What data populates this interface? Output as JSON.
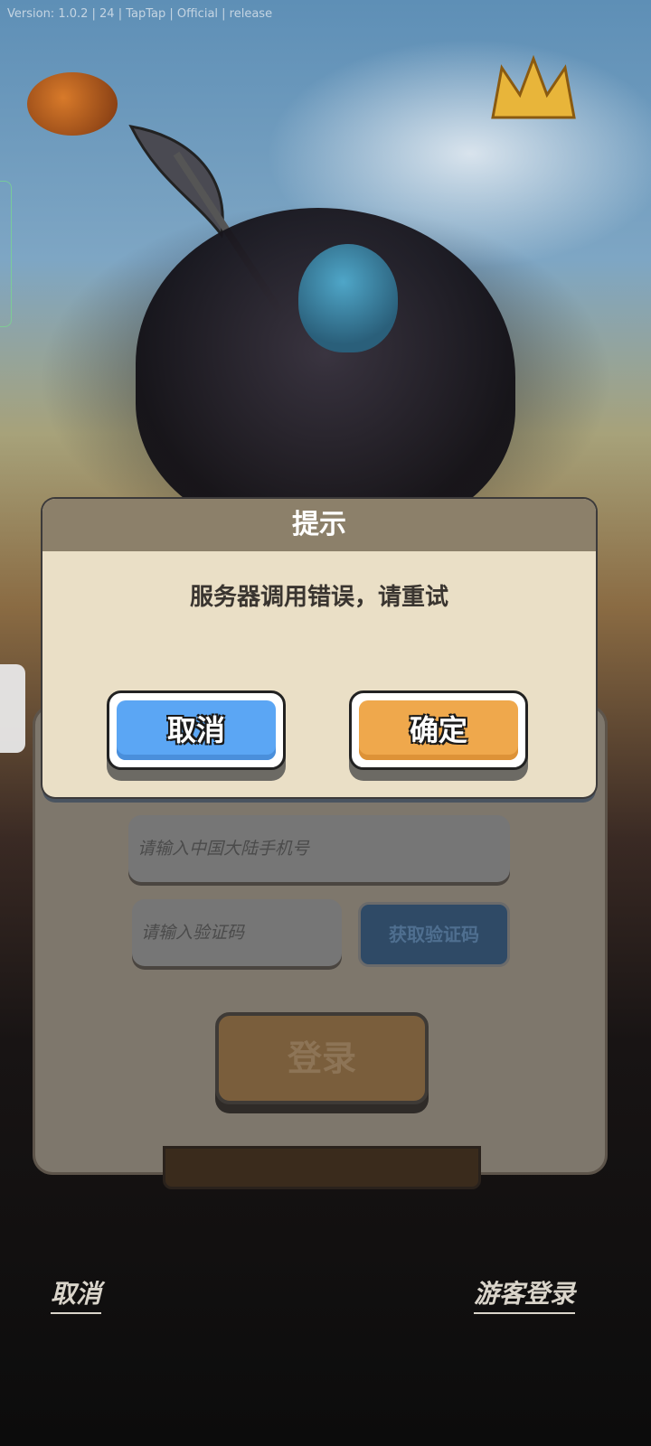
{
  "app": {
    "version_text": "Version: 1.0.2 | 24 | TapTap | Official | release"
  },
  "login_form": {
    "phone_placeholder": "请输入中国大陆手机号",
    "code_placeholder": "请输入验证码",
    "get_code_label": "获取验证码",
    "login_label": "登录"
  },
  "footer": {
    "cancel_label": "取消",
    "guest_login_label": "游客登录"
  },
  "dialog": {
    "title": "提示",
    "message": "服务器调用错误，请重试",
    "cancel_label": "取消",
    "ok_label": "确定"
  },
  "colors": {
    "dialog_bg": "#eadfc6",
    "dialog_header": "#8c806a",
    "cancel_button": "#5ba6f4",
    "ok_button": "#efa84c"
  },
  "icons": [
    "pumpkin-art",
    "crown-art",
    "hero-art"
  ]
}
